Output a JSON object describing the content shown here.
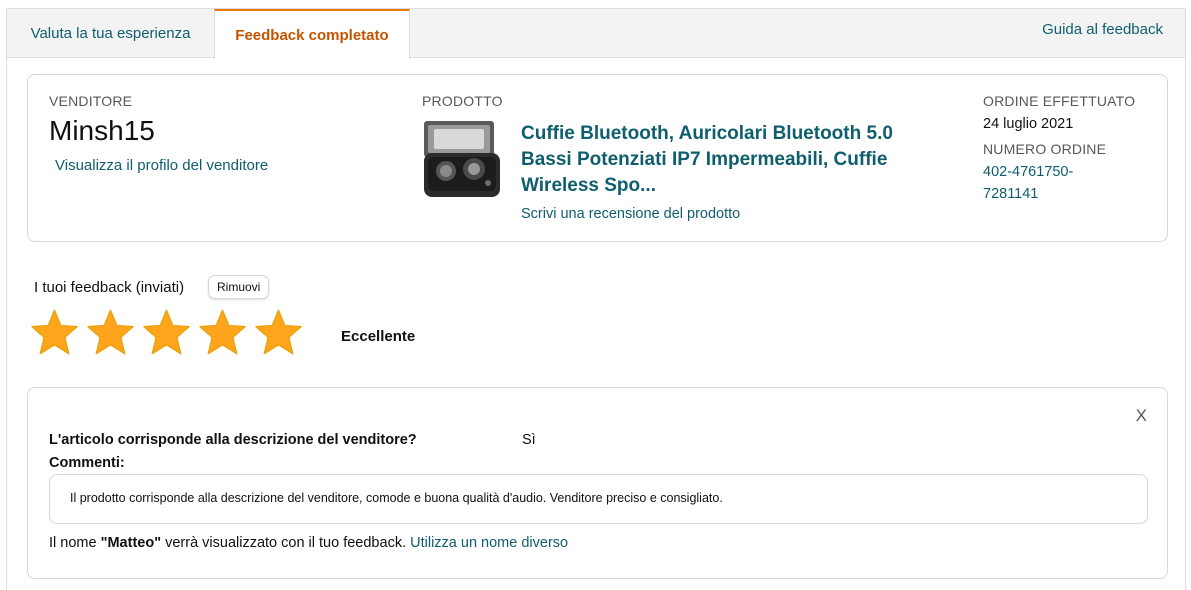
{
  "tabs": {
    "rate_label": "Valuta la tua esperienza",
    "done_label": "Feedback completato",
    "help_label": "Guida al feedback"
  },
  "seller": {
    "heading": "VENDITORE",
    "name": "Minsh15",
    "profile_link": "Visualizza il profilo del venditore"
  },
  "product": {
    "heading": "PRODOTTO",
    "title": "Cuffie Bluetooth, Auricolari Bluetooth 5.0 Bassi Potenziati IP7 Impermeabili, Cuffie Wireless Spo...",
    "review_link": "Scrivi una recensione del prodotto",
    "thumbnail_icon": "earbuds-case-image"
  },
  "order": {
    "placed_heading": "ORDINE EFFETTUATO",
    "placed_date": "24 luglio 2021",
    "number_heading": "NUMERO ORDINE",
    "number": "402-4761750-7281141"
  },
  "feedback": {
    "heading": "I tuoi feedback (inviati)",
    "remove_label": "Rimuovi",
    "rating": 5,
    "rating_max": 5,
    "rating_word": "Eccellente",
    "star_color": "#ffa41c",
    "star_outline": "#e7a512",
    "close_label": "X",
    "question": "L'articolo corrisponde alla descrizione del venditore?",
    "answer": "Sì",
    "comments_label": "Commenti:",
    "comment": "Il prodotto corrisponde alla descrizione del venditore, comode e buona qualità d'audio. Venditore preciso e consigliato.",
    "name_prefix": "Il nome ",
    "display_name": "\"Matteo\"",
    "name_suffix": " verrà visualizzato con il tuo feedback. ",
    "change_name_link": "Utilizza un nome diverso"
  },
  "colors": {
    "link": "#0f5e6e",
    "active_tab": "#c45500",
    "active_tab_border": "#e77600"
  }
}
